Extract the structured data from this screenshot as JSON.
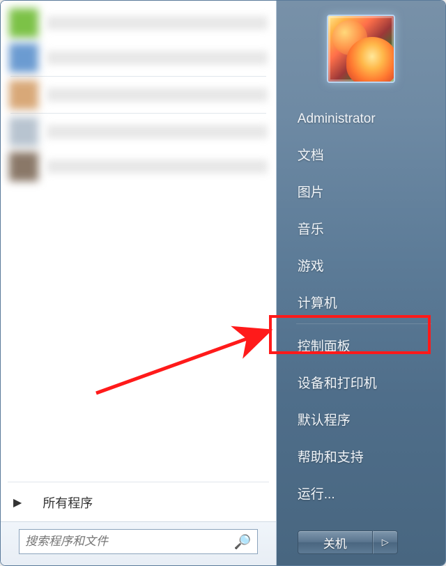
{
  "user": {
    "name": "Administrator"
  },
  "right_items_top": [
    "文档",
    "图片",
    "音乐",
    "游戏",
    "计算机"
  ],
  "right_items_mid": [
    "控制面板",
    "设备和打印机",
    "默认程序",
    "帮助和支持",
    "运行..."
  ],
  "all_programs_label": "所有程序",
  "search": {
    "placeholder": "搜索程序和文件"
  },
  "shutdown": {
    "label": "关机"
  },
  "annotation": {
    "highlighted_item": "控制面板"
  }
}
